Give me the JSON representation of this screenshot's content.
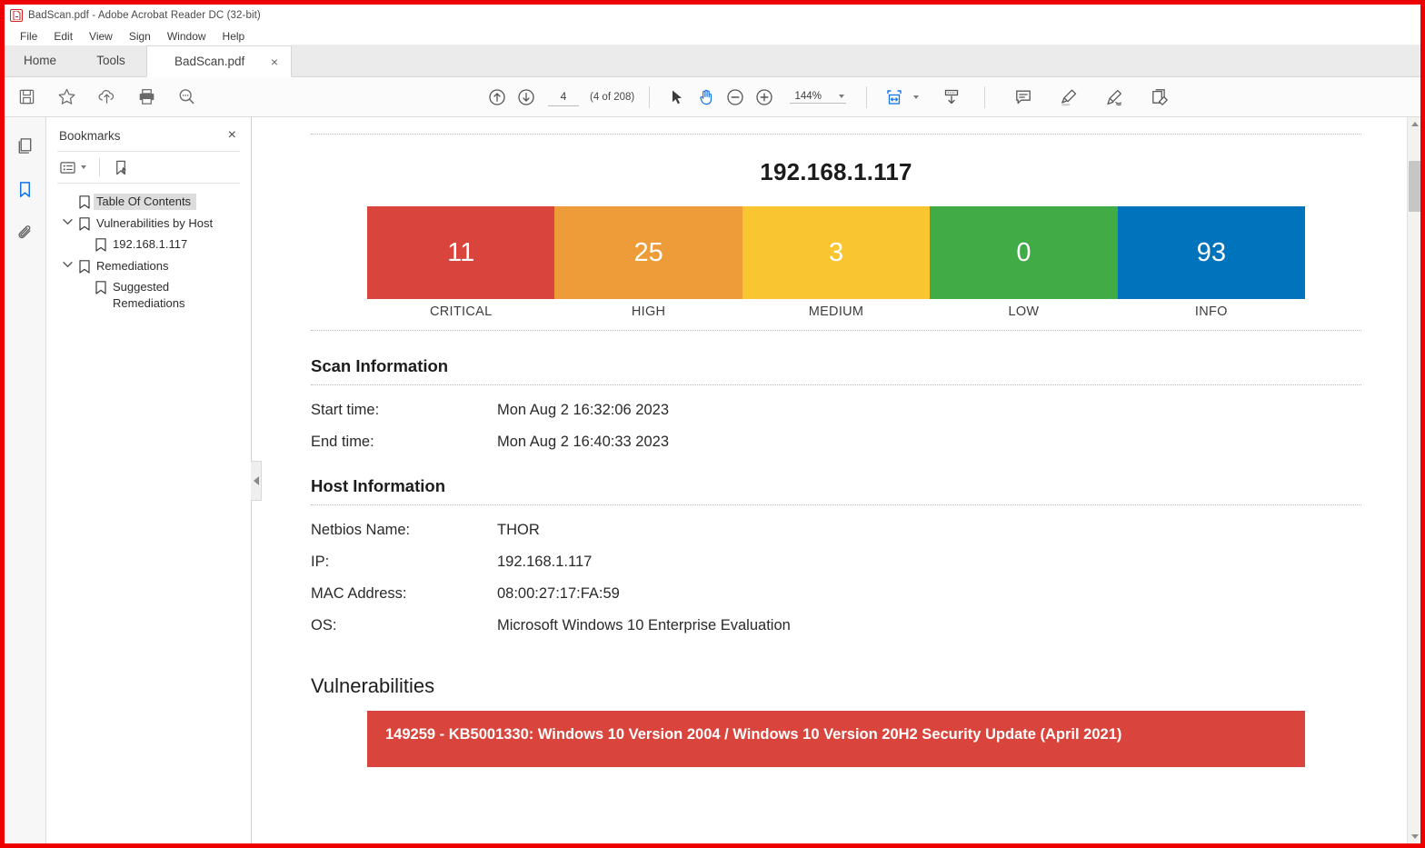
{
  "window": {
    "title": "BadScan.pdf - Adobe Acrobat Reader DC (32-bit)",
    "app_icon": "pdf-file-icon"
  },
  "menubar": {
    "items": [
      {
        "label": "File"
      },
      {
        "label": "Edit"
      },
      {
        "label": "View"
      },
      {
        "label": "Sign"
      },
      {
        "label": "Window"
      },
      {
        "label": "Help"
      }
    ]
  },
  "tabs": {
    "home": "Home",
    "tools": "Tools",
    "document": "BadScan.pdf",
    "close_label": "×"
  },
  "toolbar": {
    "left_icons": [
      {
        "name": "save-icon",
        "title": "Save"
      },
      {
        "name": "star-icon",
        "title": "Add to favorites"
      },
      {
        "name": "upload-cloud-icon",
        "title": "Upload"
      },
      {
        "name": "print-icon",
        "title": "Print"
      },
      {
        "name": "search-zoom-icon",
        "title": "Find"
      }
    ],
    "prev_page_icon": "arrow-up-circle-icon",
    "next_page_icon": "arrow-down-circle-icon",
    "page_value": "4",
    "page_count_label": "(4 of 208)",
    "select_tool_icon": "cursor-arrow-icon",
    "hand_tool_icon": "hand-tool-icon",
    "zoom_out_icon": "zoom-out-icon",
    "zoom_in_icon": "zoom-in-icon",
    "zoom_value": "144%",
    "fit_page_icon": "fit-page-icon",
    "scroll_mode_icon": "page-down-icon",
    "comment_icon": "comment-icon",
    "highlight_icon": "highlight-pen-icon",
    "sign_icon": "sign-icon",
    "fill_sign_icon": "fill-and-sign-icon"
  },
  "rail": {
    "items": [
      {
        "name": "page-thumbnails-icon",
        "label": "Page Thumbnails",
        "active": false
      },
      {
        "name": "bookmarks-icon",
        "label": "Bookmarks",
        "active": true
      },
      {
        "name": "attachments-icon",
        "label": "Attachments",
        "active": false
      }
    ]
  },
  "bookmarks_panel": {
    "title": "Bookmarks",
    "close_label": "×",
    "tools": [
      {
        "name": "bookmark-options-icon",
        "label": "Options"
      },
      {
        "name": "new-bookmark-icon",
        "label": "New Bookmark"
      }
    ],
    "items": [
      {
        "label": "Table Of Contents",
        "level": 0,
        "expandable": false,
        "selected": true
      },
      {
        "label": "Vulnerabilities by Host",
        "level": 0,
        "expandable": true,
        "selected": false
      },
      {
        "label": "192.168.1.117",
        "level": 1,
        "expandable": false,
        "selected": false
      },
      {
        "label": "Remediations",
        "level": 0,
        "expandable": true,
        "selected": false
      },
      {
        "label": "Suggested Remediations",
        "level": 1,
        "expandable": false,
        "selected": false
      }
    ]
  },
  "document": {
    "host_title": "192.168.1.117",
    "chart_data": {
      "type": "bar",
      "title": "192.168.1.117",
      "categories": [
        "CRITICAL",
        "HIGH",
        "MEDIUM",
        "LOW",
        "INFO"
      ],
      "values": [
        11,
        25,
        3,
        0,
        93
      ],
      "colors": [
        "#d9453c",
        "#ee9b3a",
        "#f9c531",
        "#41ab46",
        "#0073bd"
      ],
      "xlabel": "",
      "ylabel": "",
      "legend": "none",
      "grid": false
    },
    "scan_information": {
      "heading": "Scan Information",
      "rows": [
        {
          "key": "Start time:",
          "value": "Mon Aug 2 16:32:06 2023"
        },
        {
          "key": "End time:",
          "value": "Mon Aug 2 16:40:33 2023"
        }
      ]
    },
    "host_information": {
      "heading": "Host Information",
      "rows": [
        {
          "key": "Netbios Name:",
          "value": "THOR"
        },
        {
          "key": "IP:",
          "value": "192.168.1.117"
        },
        {
          "key": "MAC Address:",
          "value": "08:00:27:17:FA:59"
        },
        {
          "key": "OS:",
          "value": "Microsoft Windows 10 Enterprise Evaluation"
        }
      ]
    },
    "vulnerabilities": {
      "heading": "Vulnerabilities",
      "items": [
        {
          "text": "149259 - KB5001330: Windows 10 Version 2004 / Windows 10 Version 20H2 Security Update (April 2021)",
          "severity_color": "#d9453c"
        }
      ]
    }
  }
}
